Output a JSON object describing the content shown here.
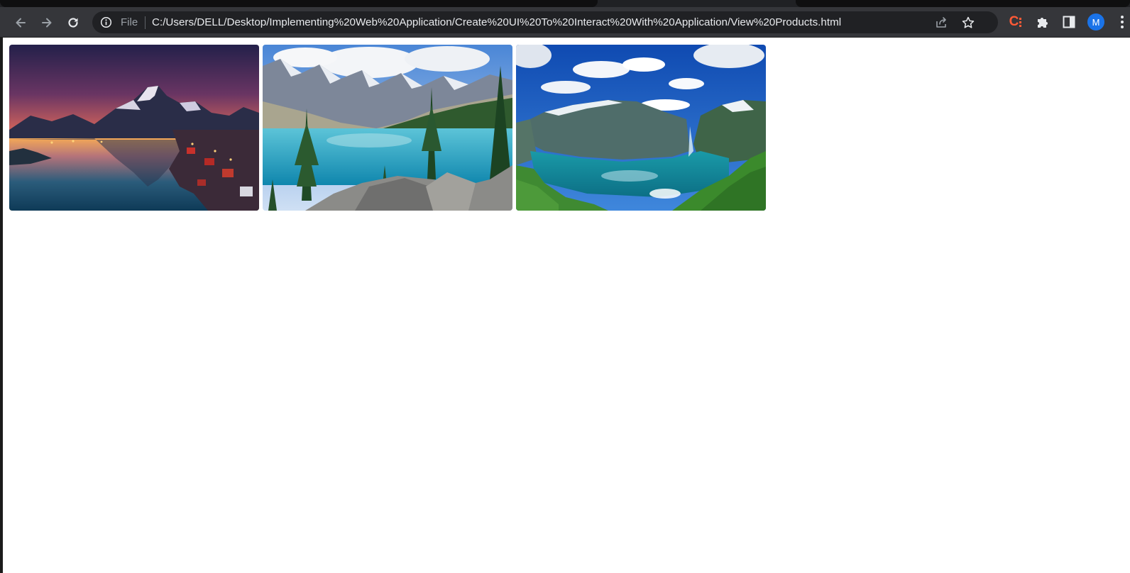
{
  "browser": {
    "address_scheme": "File",
    "url": "C:/Users/DELL/Desktop/Implementing%20Web%20Application/Create%20UI%20To%20Interact%20With%20Application/View%20Products.html",
    "profile_initial": "M",
    "extension_label": "C",
    "icons": {
      "back": "arrow-left-icon",
      "forward": "arrow-right-icon",
      "reload": "reload-icon",
      "site_info": "info-icon",
      "share": "share-icon",
      "bookmark": "star-icon",
      "extensions": "puzzle-icon",
      "side_panel": "side-panel-icon",
      "menu": "vertical-dots-icon"
    },
    "colors": {
      "toolbar": "#35363a",
      "omnibox": "#202124",
      "avatar": "#1a73e8",
      "extension": "#ff5a36"
    }
  },
  "gallery": {
    "images": [
      {
        "scene": "mountain lake at sunset with village"
      },
      {
        "scene": "turquoise mountain lake with pine trees"
      },
      {
        "scene": "fjord with green cliffs under blue sky"
      }
    ]
  }
}
